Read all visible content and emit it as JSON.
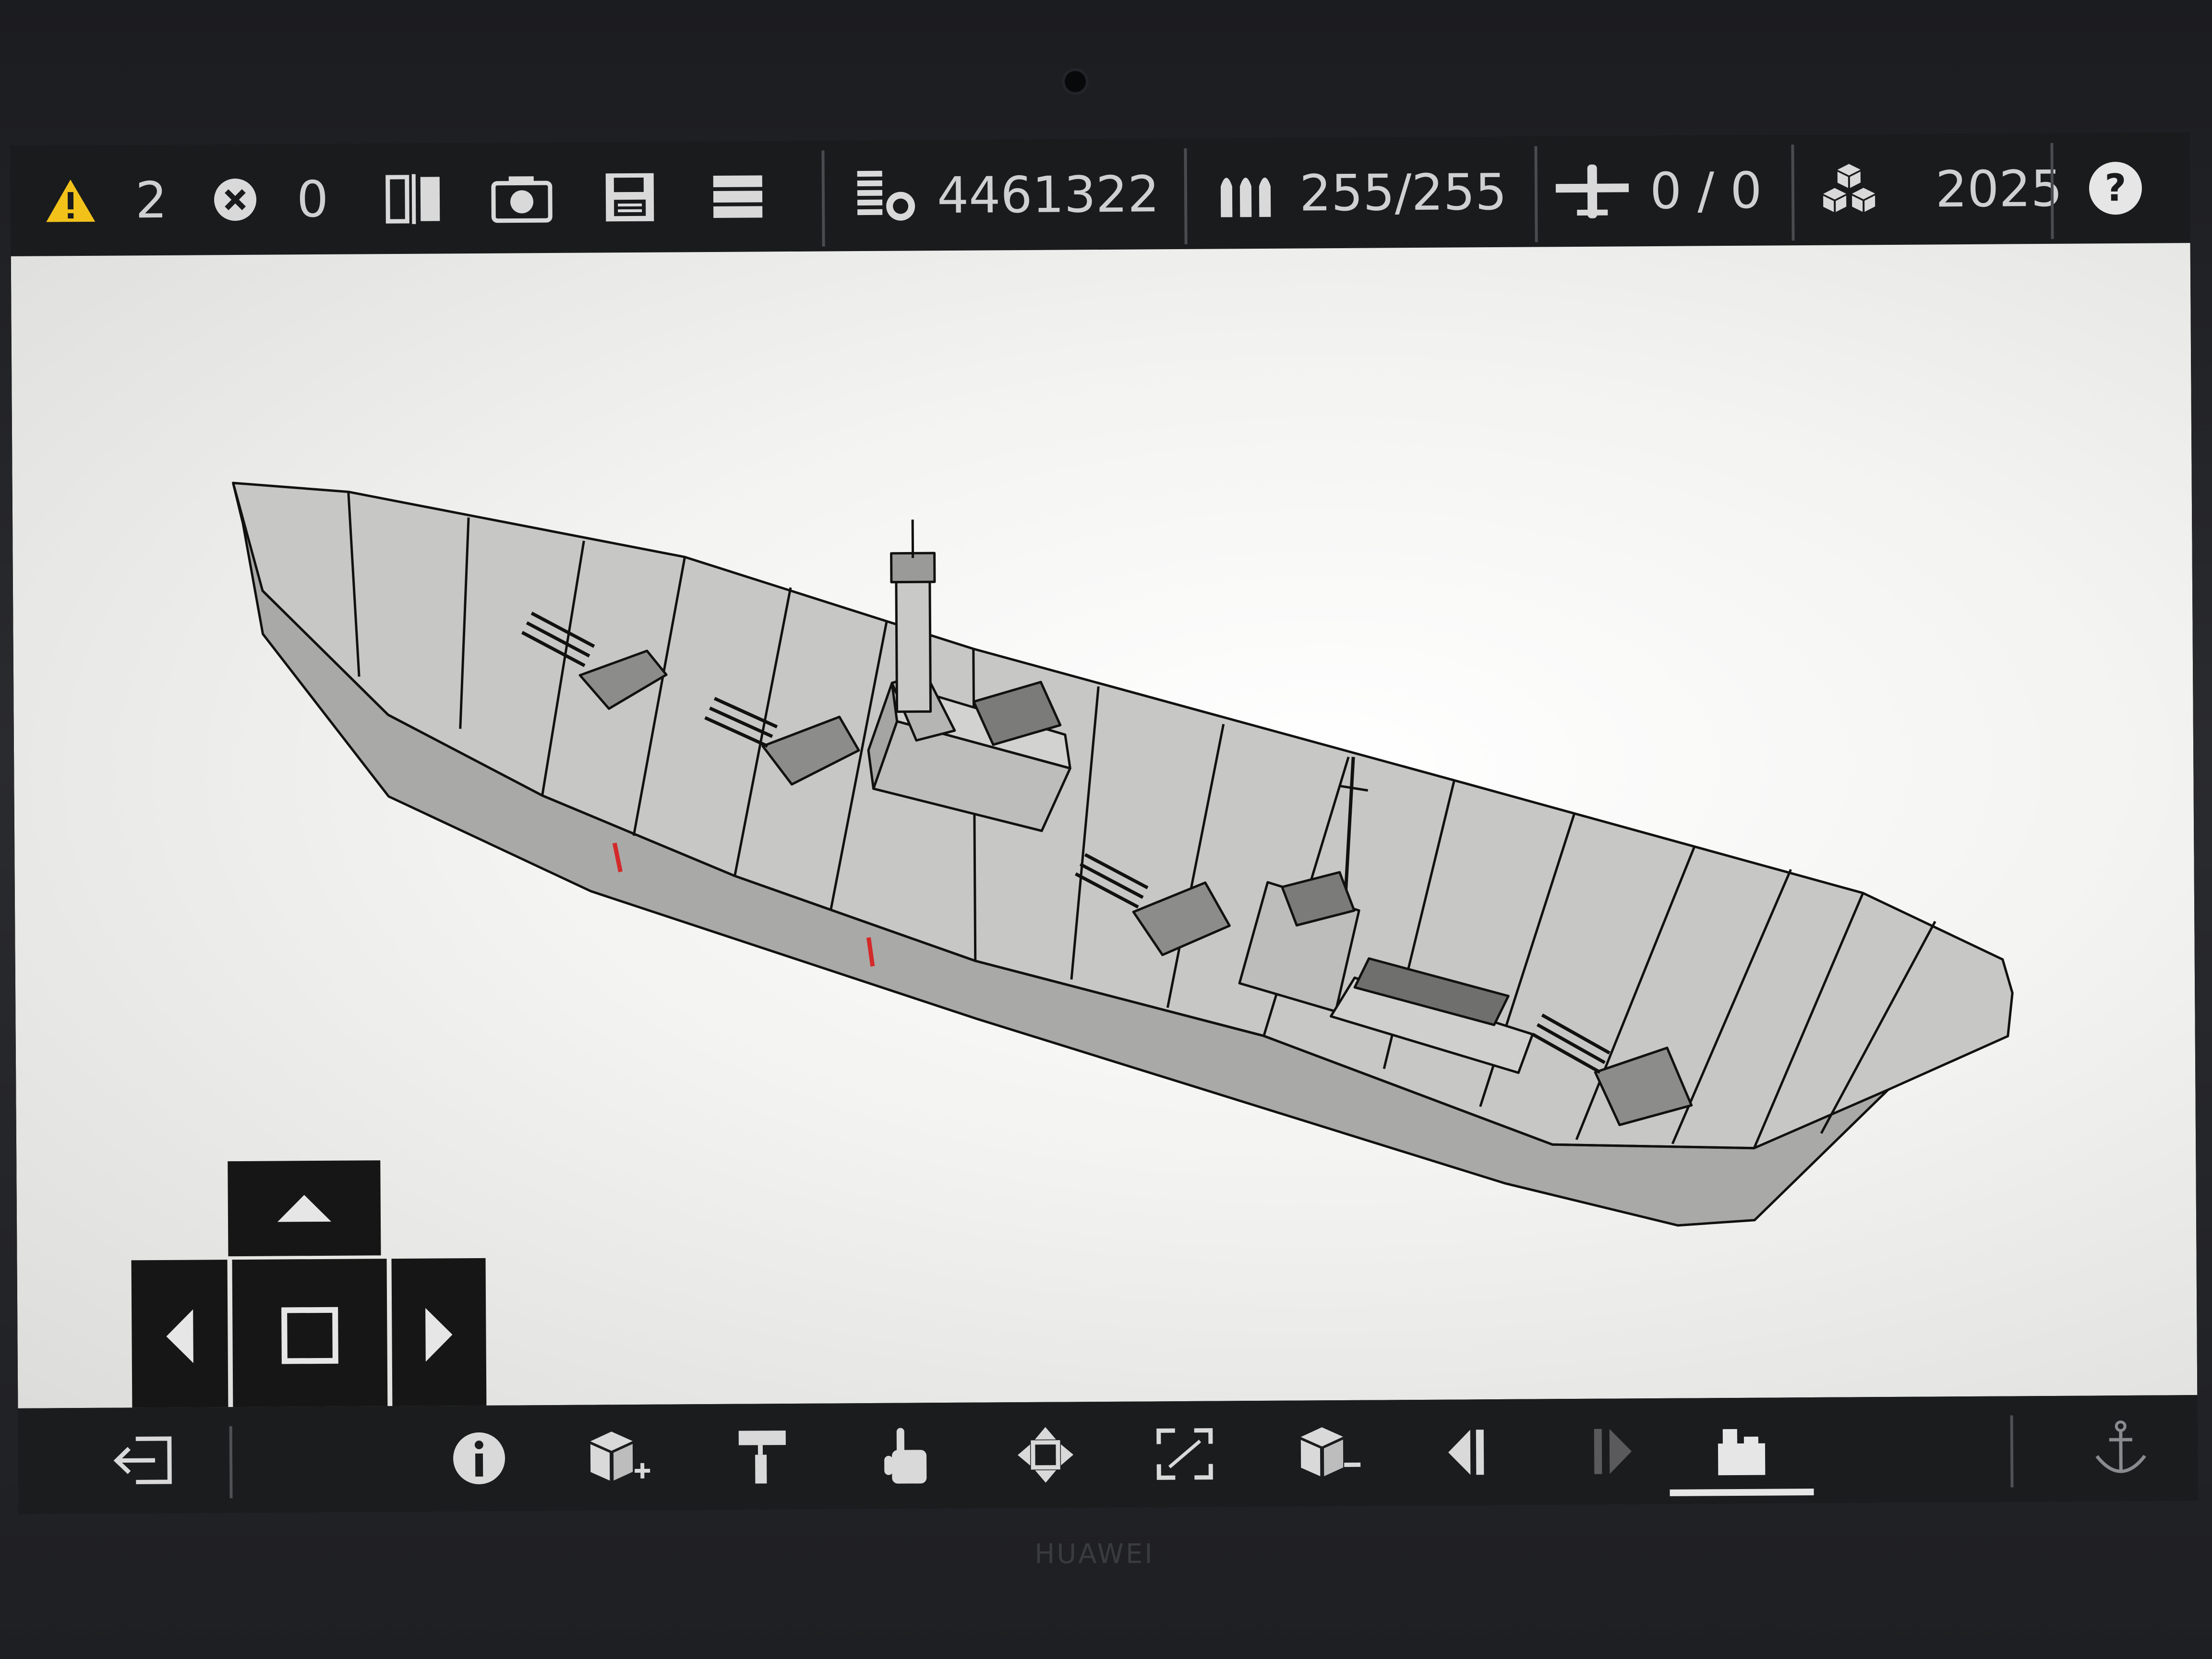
{
  "device": {
    "brand": "HUAWEI"
  },
  "topbar": {
    "warnings_count": "2",
    "errors_count": "0",
    "cost_value": "4461322",
    "ammo_value": "255/255",
    "aircraft_value": "0 / 0",
    "year_value": "2025",
    "help_label": "?"
  },
  "colors": {
    "warning": "#f2c21a",
    "bar_bg": "#1a1b1d",
    "icon": "#d9d9d9",
    "hull": "#b9b9b7",
    "deck": "#c6c6c4",
    "accent_red": "#d42a2a"
  },
  "icons": {
    "top": [
      "warning-icon",
      "error-icon",
      "mirror-icon",
      "camera-icon",
      "save-icon",
      "menu-icon",
      "cost-icon",
      "ammo-icon",
      "aircraft-icon",
      "resources-icon",
      "help-icon"
    ],
    "dpad": [
      "arrow-up-icon",
      "arrow-left-icon",
      "square-icon",
      "arrow-right-icon",
      "arrow-down-icon"
    ],
    "bottom": [
      "exit-icon",
      "info-icon",
      "add-block-icon",
      "paint-roller-icon",
      "hand-pointer-icon",
      "move-icon",
      "resize-icon",
      "remove-block-icon",
      "previous-icon",
      "next-icon",
      "structure-icon",
      "anchor-icon"
    ]
  },
  "bottombar": {
    "active_tool": "structure-icon"
  }
}
